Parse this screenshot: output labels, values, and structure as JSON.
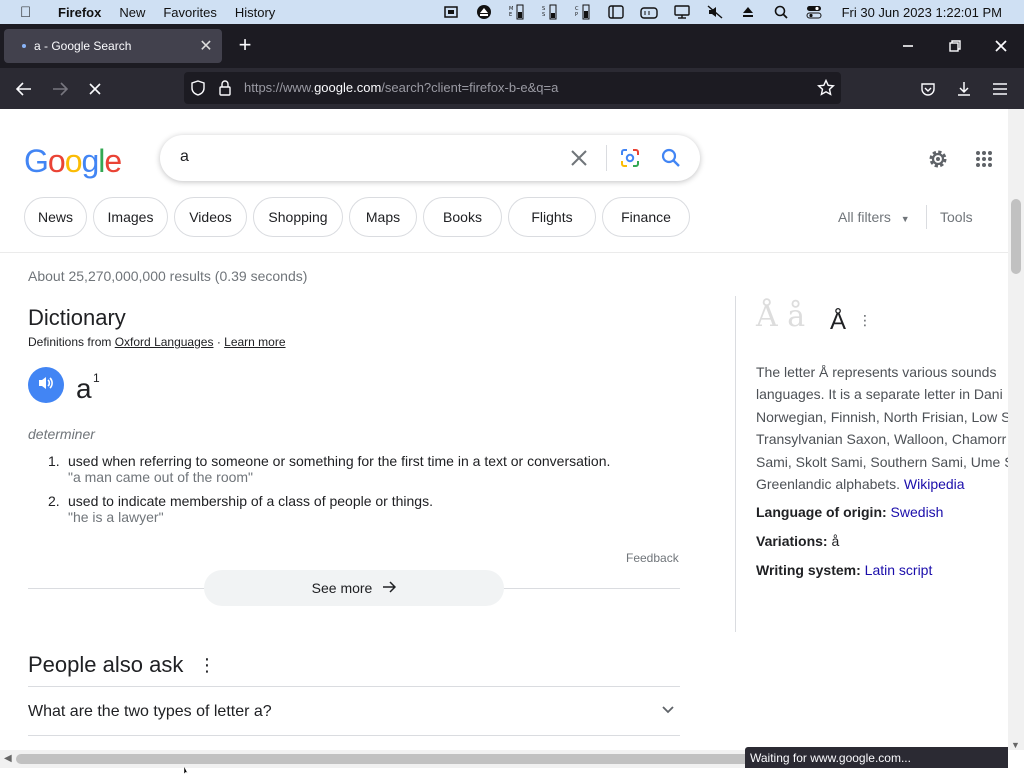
{
  "menubar": {
    "app": "Firefox",
    "items": [
      "New",
      "Favorites",
      "History"
    ],
    "clock": "Fri 30 Jun 2023  1:22:01 PM"
  },
  "browser": {
    "tab_title": "a - Google Search",
    "url_prefix": "https://www.",
    "url_domain": "google.com",
    "url_rest": "/search?client=firefox-b-e&q=a",
    "status": "Waiting for www.google.com..."
  },
  "google": {
    "query": "a",
    "chips": [
      "News",
      "Images",
      "Videos",
      "Shopping",
      "Maps",
      "Books",
      "Flights",
      "Finance"
    ],
    "all_filters": "All filters",
    "tools": "Tools",
    "stats": "About 25,270,000,000 results (0.39 seconds)"
  },
  "dictionary": {
    "title": "Dictionary",
    "source_prefix": "Definitions from",
    "source_name": "Oxford Languages",
    "separator": "·",
    "learn_more": "Learn more",
    "word": "a",
    "superscript": "1",
    "part_of_speech": "determiner",
    "definitions": [
      {
        "num": "1.",
        "text": "used when referring to someone or something for the first time in a text or conversation.",
        "example": "\"a man came out of the room\""
      },
      {
        "num": "2.",
        "text": "used to indicate membership of a class of people or things.",
        "example": "\"he is a lawyer\""
      }
    ],
    "feedback": "Feedback",
    "see_more": "See more"
  },
  "people_also_ask": {
    "title": "People also ask",
    "questions": [
      "What are the two types of letter a?"
    ]
  },
  "knowledge_panel": {
    "image_text": "Å å",
    "title": "Å",
    "description_lines": [
      "The letter Å represents various sounds",
      "languages. It is a separate letter in Dani",
      "Norwegian, Finnish, North Frisian, Low S",
      "Transylvanian Saxon, Walloon, Chamorr",
      "Sami, Skolt Sami, Southern Sami, Ume S",
      "Greenlandic alphabets."
    ],
    "wikipedia": "Wikipedia",
    "facts": [
      {
        "label": "Language of origin:",
        "value": "Swedish",
        "link": true
      },
      {
        "label": "Variations:",
        "value": "å",
        "link": false
      },
      {
        "label": "Writing system:",
        "value": "Latin script",
        "link": true
      }
    ]
  },
  "colors": {
    "google_blue": "#4285f4",
    "google_red": "#ea4335",
    "google_yellow": "#fbbc05",
    "google_green": "#34a853",
    "link": "#1a0dab"
  }
}
